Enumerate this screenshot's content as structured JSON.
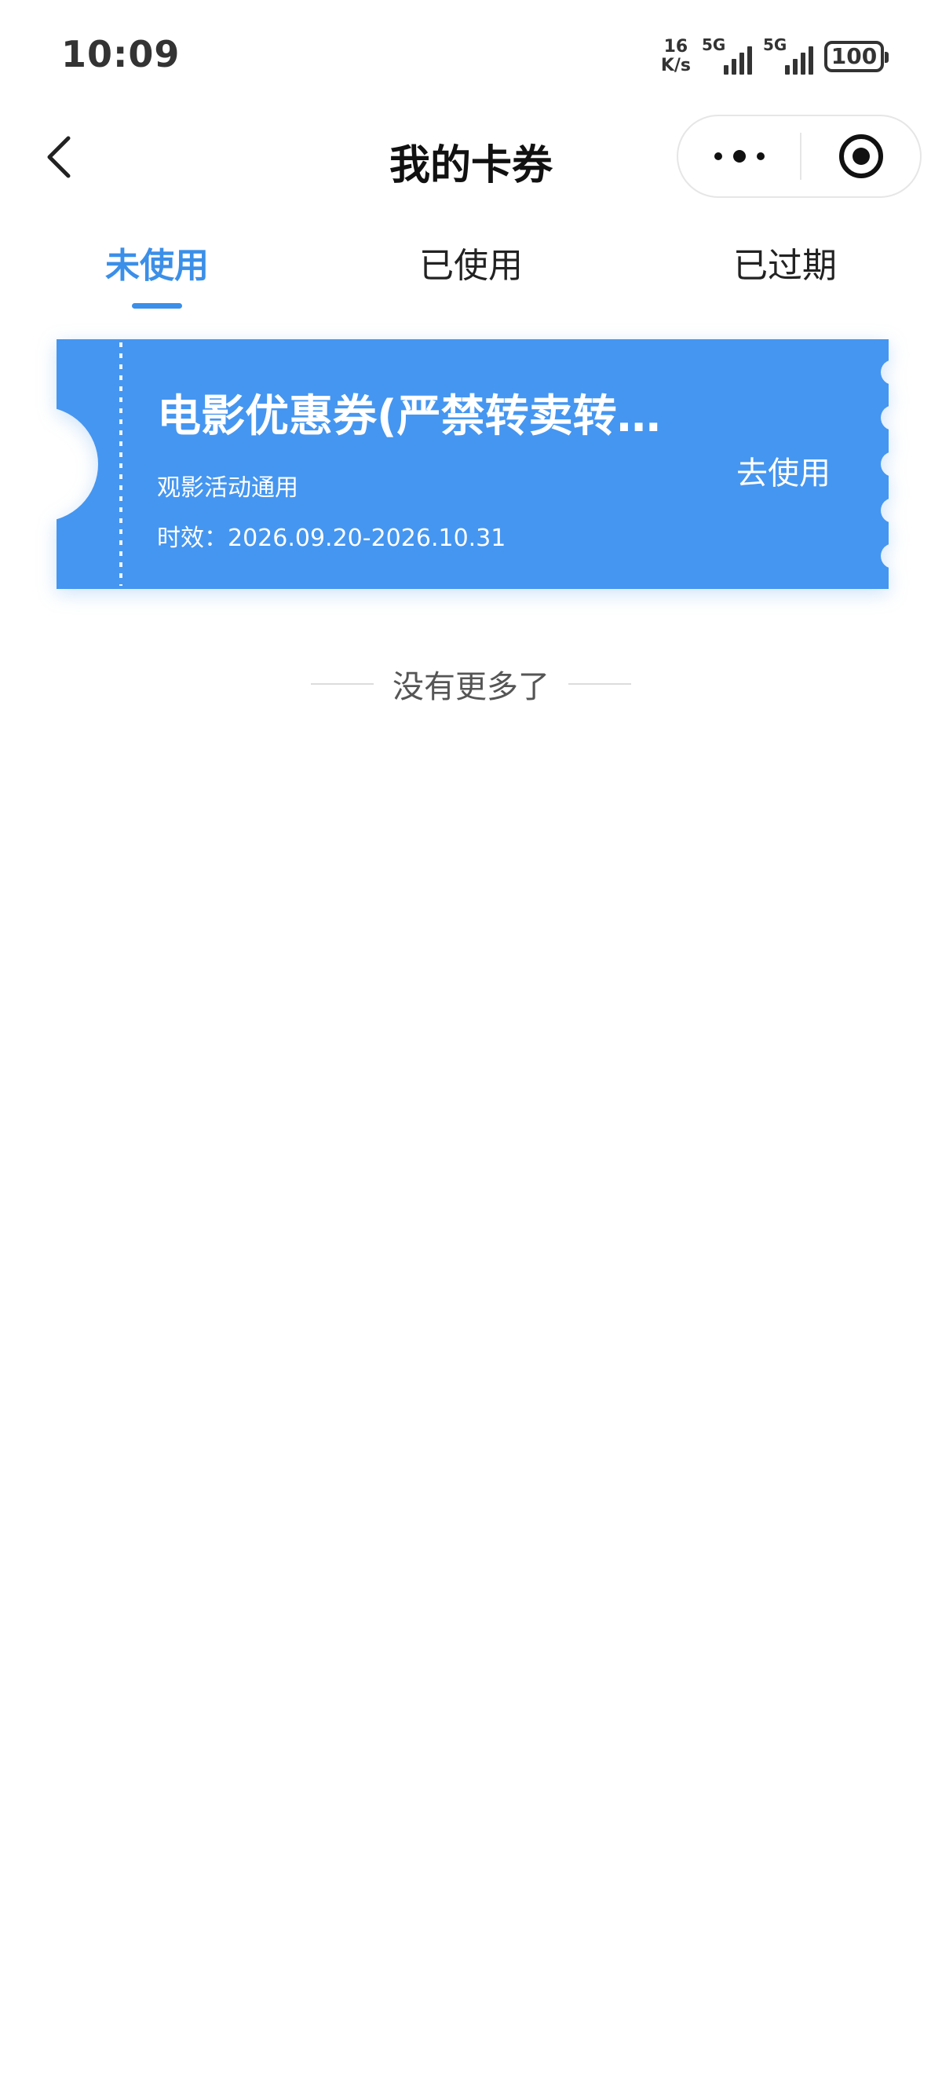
{
  "status_bar": {
    "time": "10:09",
    "net_speed_value": "16",
    "net_speed_unit": "K/s",
    "signal_1_label": "5G",
    "signal_2_label": "5G",
    "battery_level": "100"
  },
  "nav": {
    "title": "我的卡券",
    "back_icon": "chevron-left-icon",
    "more_icon": "more-dots-icon",
    "close_icon": "target-circle-icon"
  },
  "tabs": [
    {
      "label": "未使用",
      "active": true
    },
    {
      "label": "已使用",
      "active": false
    },
    {
      "label": "已过期",
      "active": false
    }
  ],
  "coupons": [
    {
      "name": "电影优惠券(严禁转卖转…",
      "desc": "观影活动通用",
      "validity": "时效：2026.09.20-2026.10.31",
      "action": "去使用"
    }
  ],
  "footer_text": "没有更多了",
  "colors": {
    "accent": "#3b8fe8",
    "coupon_bg": "#4596f0",
    "text_primary": "#111111"
  }
}
